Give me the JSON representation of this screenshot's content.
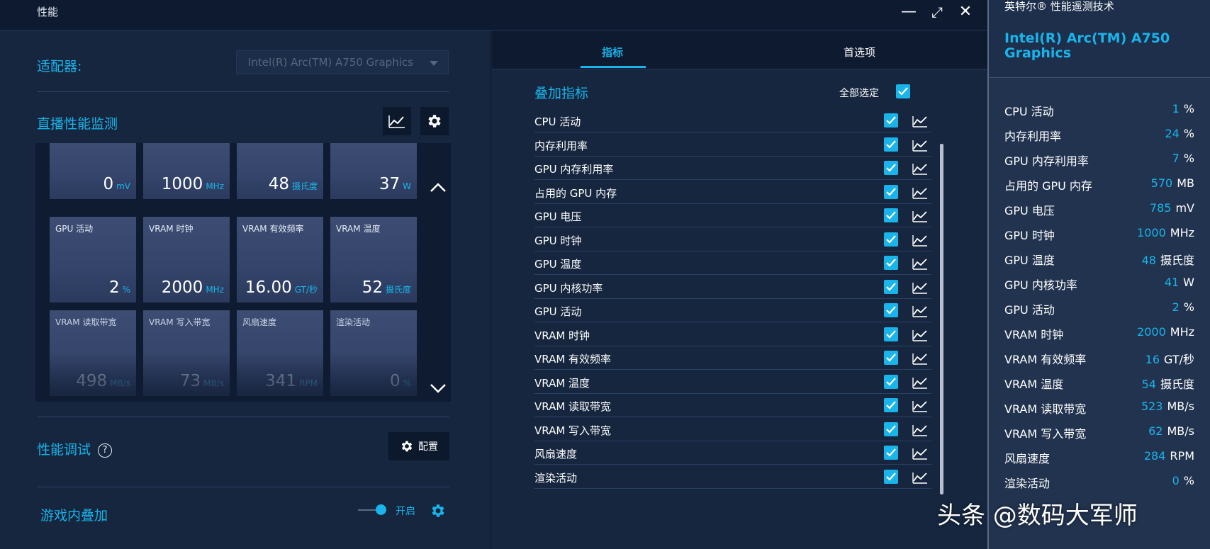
{
  "window": {
    "title": "性能",
    "minimize": "—",
    "maximize": "⤢",
    "close": "✕"
  },
  "adapter": {
    "label": "适配器:",
    "selected": "Intel(R) Arc(TM) A750 Graphics"
  },
  "live_monitor": {
    "title": "直播性能监测",
    "tiles": [
      {
        "label": "",
        "value": "0",
        "unit": "mV",
        "dim": false
      },
      {
        "label": "",
        "value": "1000",
        "unit": "MHz",
        "dim": false
      },
      {
        "label": "",
        "value": "48",
        "unit": "摄氏度",
        "dim": false
      },
      {
        "label": "",
        "value": "37",
        "unit": "W",
        "dim": false
      },
      {
        "label": "GPU 活动",
        "value": "2",
        "unit": "%",
        "dim": false
      },
      {
        "label": "VRAM 时钟",
        "value": "2000",
        "unit": "MHz",
        "dim": false
      },
      {
        "label": "VRAM 有效频率",
        "value": "16.00",
        "unit": "GT/秒",
        "dim": false
      },
      {
        "label": "VRAM 温度",
        "value": "52",
        "unit": "摄氏度",
        "dim": false
      },
      {
        "label": "VRAM 读取带宽",
        "value": "498",
        "unit": "MB/s",
        "dim": true
      },
      {
        "label": "VRAM 写入带宽",
        "value": "73",
        "unit": "MB/s",
        "dim": true
      },
      {
        "label": "风扇速度",
        "value": "341",
        "unit": "RPM",
        "dim": true
      },
      {
        "label": "渲染活动",
        "value": "0",
        "unit": "%",
        "dim": true
      }
    ]
  },
  "tuning": {
    "title": "性能调试",
    "help": "?",
    "config_label": "配置"
  },
  "in_game_overlay": {
    "title": "游戏内叠加",
    "toggle_label": "开启"
  },
  "tabs": [
    {
      "label": "指标"
    },
    {
      "label": "首选项"
    }
  ],
  "overlay_metrics": {
    "title": "叠加指标",
    "select_all": "全部选定",
    "items": [
      "CPU 活动",
      "内存利用率",
      "GPU 内存利用率",
      "占用的 GPU 内存",
      "GPU 电压",
      "GPU 时钟",
      "GPU 温度",
      "GPU 内核功率",
      "GPU 活动",
      "VRAM 时钟",
      "VRAM 有效频率",
      "VRAM 温度",
      "VRAM 读取带宽",
      "VRAM 写入带宽",
      "风扇速度",
      "渲染活动"
    ]
  },
  "overlay_panel": {
    "brand": "英特尔® 性能遥测技术",
    "gpu_name": "Intel(R) Arc(TM) A750 Graphics",
    "rows": [
      {
        "label": "CPU 活动",
        "value": "1",
        "unit": "%"
      },
      {
        "label": "内存利用率",
        "value": "24",
        "unit": "%"
      },
      {
        "label": "GPU 内存利用率",
        "value": "7",
        "unit": "%"
      },
      {
        "label": "占用的 GPU 内存",
        "value": "570",
        "unit": "MB"
      },
      {
        "label": "GPU 电压",
        "value": "785",
        "unit": "mV"
      },
      {
        "label": "GPU 时钟",
        "value": "1000",
        "unit": "MHz"
      },
      {
        "label": "GPU 温度",
        "value": "48",
        "unit": "摄氏度"
      },
      {
        "label": "GPU 内核功率",
        "value": "41",
        "unit": "W"
      },
      {
        "label": "GPU 活动",
        "value": "2",
        "unit": "%"
      },
      {
        "label": "VRAM 时钟",
        "value": "2000",
        "unit": "MHz"
      },
      {
        "label": "VRAM 有效频率",
        "value": "16",
        "unit": "GT/秒"
      },
      {
        "label": "VRAM 温度",
        "value": "54",
        "unit": "摄氏度"
      },
      {
        "label": "VRAM 读取带宽",
        "value": "523",
        "unit": "MB/s"
      },
      {
        "label": "VRAM 写入带宽",
        "value": "62",
        "unit": "MB/s"
      },
      {
        "label": "风扇速度",
        "value": "284",
        "unit": "RPM"
      },
      {
        "label": "渲染活动",
        "value": "0",
        "unit": "%"
      }
    ]
  },
  "watermark": "头条 @数码大军师",
  "colors": {
    "accent": "#19b4ea",
    "background": "#16263f",
    "titlebar": "#0d1a2f",
    "tile": "#3c4c72"
  }
}
